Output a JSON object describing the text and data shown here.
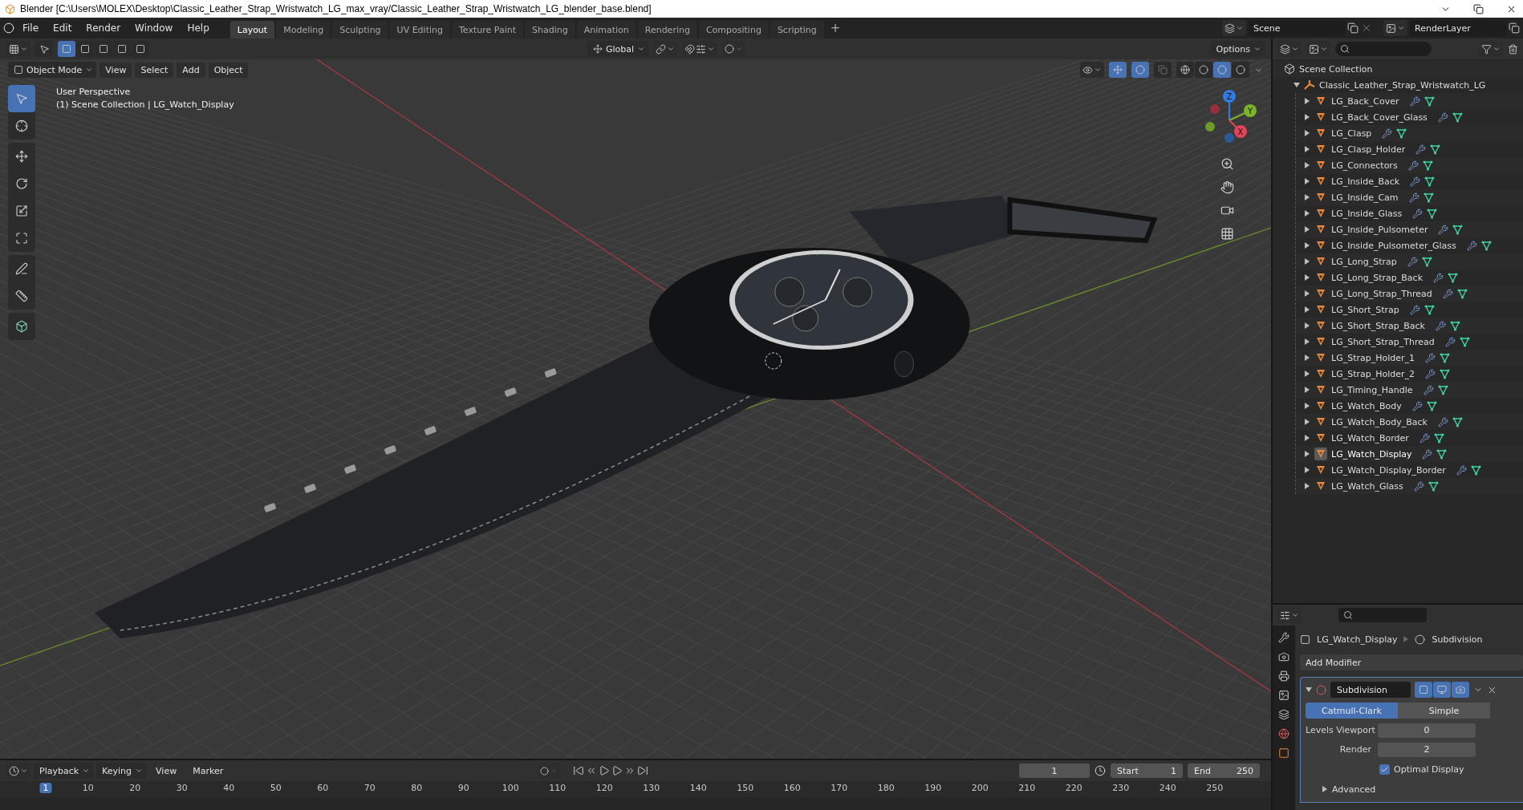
{
  "window": {
    "title": "Blender [C:\\Users\\MOLEX\\Desktop\\Classic_Leather_Strap_Wristwatch_LG_max_vray/Classic_Leather_Strap_Wristwatch_LG_blender_base.blend]"
  },
  "menu": [
    "File",
    "Edit",
    "Render",
    "Window",
    "Help"
  ],
  "workspaces": [
    {
      "label": "Layout",
      "selected": true
    },
    {
      "label": "Modeling",
      "selected": false
    },
    {
      "label": "Sculpting",
      "selected": false
    },
    {
      "label": "UV Editing",
      "selected": false
    },
    {
      "label": "Texture Paint",
      "selected": false
    },
    {
      "label": "Shading",
      "selected": false
    },
    {
      "label": "Animation",
      "selected": false
    },
    {
      "label": "Rendering",
      "selected": false
    },
    {
      "label": "Compositing",
      "selected": false
    },
    {
      "label": "Scripting",
      "selected": false
    }
  ],
  "add_workspace": "+",
  "scene": {
    "scene": "Scene",
    "view_layer": "RenderLayer"
  },
  "tool_header": {
    "orientation": "Global",
    "options": "Options"
  },
  "viewport_header": {
    "mode": "Object Mode",
    "menus": [
      "View",
      "Select",
      "Add",
      "Object"
    ],
    "shading_modes": [
      {
        "selected": false
      },
      {
        "selected": false
      },
      {
        "selected": true
      },
      {
        "selected": false
      }
    ]
  },
  "viewport": {
    "overlay_lines": [
      "User Perspective",
      "(1) Scene Collection | LG_Watch_Display"
    ],
    "gizmo_axes": [
      "Z",
      "Y",
      "X"
    ]
  },
  "outliner": {
    "root": "Scene Collection",
    "collection": {
      "name": "Classic_Leather_Strap_Wristwatch_LG",
      "expanded": true,
      "children": [
        {
          "name": "LG_Back_Cover",
          "selected": false,
          "expanded": false
        },
        {
          "name": "LG_Back_Cover_Glass",
          "selected": false,
          "expanded": false
        },
        {
          "name": "LG_Clasp",
          "selected": false,
          "expanded": false
        },
        {
          "name": "LG_Clasp_Holder",
          "selected": false,
          "expanded": false
        },
        {
          "name": "LG_Connectors",
          "selected": false,
          "expanded": false
        },
        {
          "name": "LG_Inside_Back",
          "selected": false,
          "expanded": false
        },
        {
          "name": "LG_Inside_Cam",
          "selected": false,
          "expanded": false
        },
        {
          "name": "LG_Inside_Glass",
          "selected": false,
          "expanded": false
        },
        {
          "name": "LG_Inside_Pulsometer",
          "selected": false,
          "expanded": false
        },
        {
          "name": "LG_Inside_Pulsometer_Glass",
          "selected": false,
          "expanded": false
        },
        {
          "name": "LG_Long_Strap",
          "selected": false,
          "expanded": false
        },
        {
          "name": "LG_Long_Strap_Back",
          "selected": false,
          "expanded": false
        },
        {
          "name": "LG_Long_Strap_Thread",
          "selected": false,
          "expanded": false
        },
        {
          "name": "LG_Short_Strap",
          "selected": false,
          "expanded": false
        },
        {
          "name": "LG_Short_Strap_Back",
          "selected": false,
          "expanded": false
        },
        {
          "name": "LG_Short_Strap_Thread",
          "selected": false,
          "expanded": false
        },
        {
          "name": "LG_Strap_Holder_1",
          "selected": false,
          "expanded": false
        },
        {
          "name": "LG_Strap_Holder_2",
          "selected": false,
          "expanded": false
        },
        {
          "name": "LG_Timing_Handle",
          "selected": false,
          "expanded": false
        },
        {
          "name": "LG_Watch_Body",
          "selected": false,
          "expanded": false
        },
        {
          "name": "LG_Watch_Body_Back",
          "selected": false,
          "expanded": false
        },
        {
          "name": "LG_Watch_Border",
          "selected": false,
          "expanded": false
        },
        {
          "name": "LG_Watch_Display",
          "selected": true,
          "expanded": false
        },
        {
          "name": "LG_Watch_Display_Border",
          "selected": false,
          "expanded": false
        },
        {
          "name": "LG_Watch_Glass",
          "selected": false,
          "expanded": false
        }
      ]
    }
  },
  "properties": {
    "object": "LG_Watch_Display",
    "modifier_crumb": "Subdivision",
    "add_modifier": "Add Modifier",
    "modifier": {
      "name": "Subdivision",
      "expanded": true,
      "types": [
        {
          "label": "Catmull-Clark",
          "selected": true
        },
        {
          "label": "Simple",
          "selected": false
        }
      ],
      "fields": [
        {
          "label": "Levels Viewport",
          "value": "0"
        },
        {
          "label": "Render",
          "value": "2"
        }
      ],
      "optimal_display": {
        "label": "Optimal Display",
        "checked": true
      },
      "advanced": {
        "label": "Advanced",
        "expanded": false
      }
    }
  },
  "timeline": {
    "menus": [
      "Playback",
      "Keying",
      "View",
      "Marker"
    ],
    "current_frame": "1",
    "start_label": "Start",
    "start": "1",
    "end_label": "End",
    "end": "250",
    "ruler": [
      {
        "label": "1",
        "selected": true
      },
      {
        "label": "10",
        "selected": false
      },
      {
        "label": "20",
        "selected": false
      },
      {
        "label": "30",
        "selected": false
      },
      {
        "label": "40",
        "selected": false
      },
      {
        "label": "50",
        "selected": false
      },
      {
        "label": "60",
        "selected": false
      },
      {
        "label": "70",
        "selected": false
      },
      {
        "label": "80",
        "selected": false
      },
      {
        "label": "90",
        "selected": false
      },
      {
        "label": "100",
        "selected": false
      },
      {
        "label": "110",
        "selected": false
      },
      {
        "label": "120",
        "selected": false
      },
      {
        "label": "130",
        "selected": false
      },
      {
        "label": "140",
        "selected": false
      },
      {
        "label": "150",
        "selected": false
      },
      {
        "label": "160",
        "selected": false
      },
      {
        "label": "170",
        "selected": false
      },
      {
        "label": "180",
        "selected": false
      },
      {
        "label": "190",
        "selected": false
      },
      {
        "label": "200",
        "selected": false
      },
      {
        "label": "210",
        "selected": false
      },
      {
        "label": "220",
        "selected": false
      },
      {
        "label": "230",
        "selected": false
      },
      {
        "label": "240",
        "selected": false
      },
      {
        "label": "250",
        "selected": false
      }
    ]
  }
}
